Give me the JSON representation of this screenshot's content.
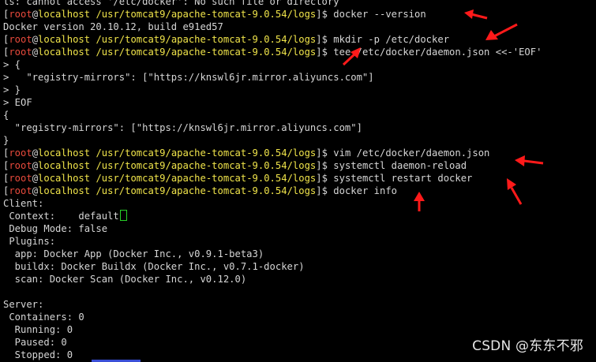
{
  "prompt": {
    "user": "root",
    "host": "localhost",
    "path": "/usr/tomcat9/apache-tomcat-9.0.54/logs"
  },
  "lines": [
    {
      "type": "text",
      "text": "ls: cannot access '/etc/docker': No such file or directory"
    },
    {
      "type": "cmd",
      "cmd": "docker --version"
    },
    {
      "type": "text",
      "text": "Docker version 20.10.12, build e91ed57"
    },
    {
      "type": "cmd",
      "cmd": "mkdir -p /etc/docker"
    },
    {
      "type": "cmd",
      "cmd": "tee /etc/docker/daemon.json <<-'EOF'"
    },
    {
      "type": "text",
      "text": "> {"
    },
    {
      "type": "text",
      "text": ">   \"registry-mirrors\": [\"https://knswl6jr.mirror.aliyuncs.com\"]"
    },
    {
      "type": "text",
      "text": "> }"
    },
    {
      "type": "text",
      "text": "> EOF"
    },
    {
      "type": "text",
      "text": "{"
    },
    {
      "type": "text",
      "text": "  \"registry-mirrors\": [\"https://knswl6jr.mirror.aliyuncs.com\"]"
    },
    {
      "type": "text",
      "text": "}"
    },
    {
      "type": "cmd",
      "cmd": "vim /etc/docker/daemon.json"
    },
    {
      "type": "cmd",
      "cmd": "systemctl daemon-reload"
    },
    {
      "type": "cmd",
      "cmd": "systemctl restart docker"
    },
    {
      "type": "cmd",
      "cmd": "docker info"
    },
    {
      "type": "text",
      "text": "Client:"
    },
    {
      "type": "cursor",
      "text": " Context:    default"
    },
    {
      "type": "text",
      "text": " Debug Mode: false"
    },
    {
      "type": "text",
      "text": " Plugins:"
    },
    {
      "type": "text",
      "text": "  app: Docker App (Docker Inc., v0.9.1-beta3)"
    },
    {
      "type": "text",
      "text": "  buildx: Docker Buildx (Docker Inc., v0.7.1-docker)"
    },
    {
      "type": "text",
      "text": "  scan: Docker Scan (Docker Inc., v0.12.0)"
    },
    {
      "type": "text",
      "text": ""
    },
    {
      "type": "text",
      "text": "Server:"
    },
    {
      "type": "text",
      "text": " Containers: 0"
    },
    {
      "type": "text",
      "text": "  Running: 0"
    },
    {
      "type": "text",
      "text": "  Paused: 0"
    },
    {
      "type": "text",
      "text": "  Stopped: 0"
    }
  ],
  "watermark": "CSDN @东东不邪",
  "colors": {
    "background": "#000000",
    "text": "#d6d6d6",
    "prompt_user": "#e84a3c",
    "prompt_path": "#f0e44a",
    "annotation_arrow": "#ff1a1a",
    "cursor": "#27d127"
  }
}
